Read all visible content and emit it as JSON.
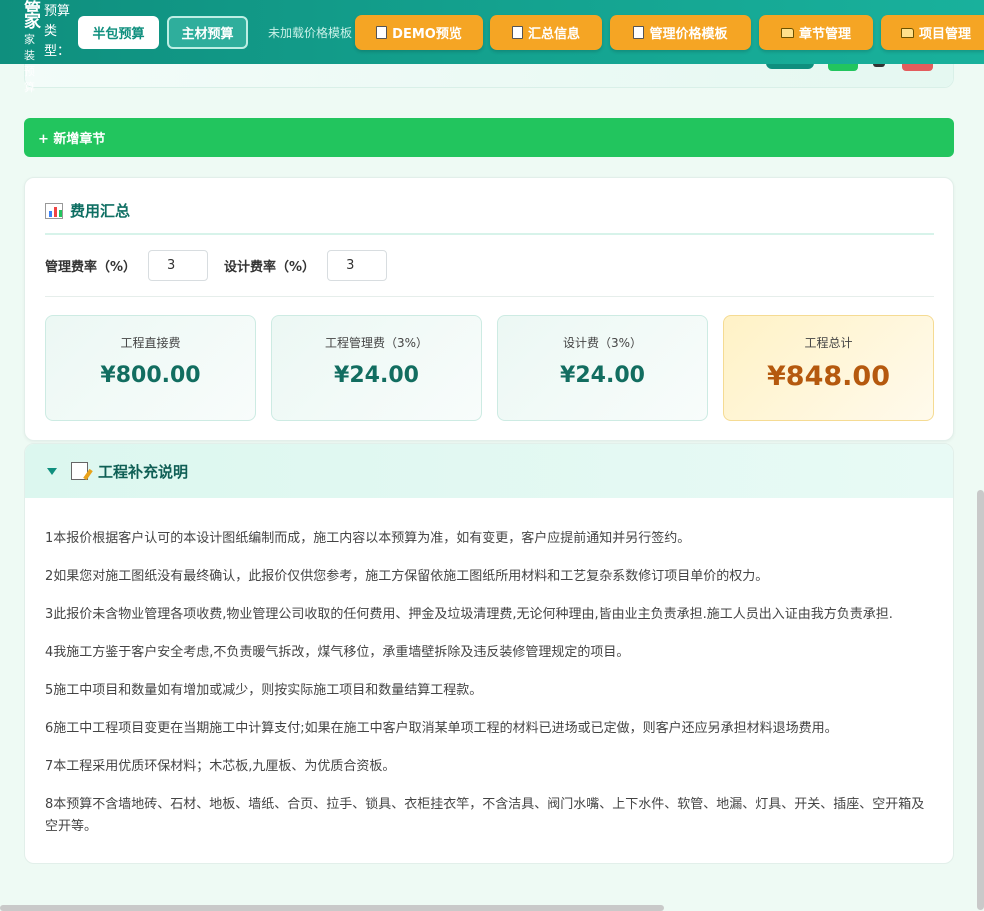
{
  "brand": {
    "line1": "管",
    "line2": "家",
    "sub": "家装预算"
  },
  "header": {
    "type_label": "预算类型：",
    "half_label": "半包预算",
    "main_label": "主材预算",
    "template_note": "未加载价格模板",
    "buttons": [
      {
        "label": "DEMO预览",
        "icon": "document-icon"
      },
      {
        "label": "汇总信息",
        "icon": "clipboard-icon"
      },
      {
        "label": "管理价格模板",
        "icon": "page-icon"
      },
      {
        "label": "章节管理",
        "icon": "folder-icon"
      },
      {
        "label": "项目管理",
        "icon": "folder-icon"
      }
    ]
  },
  "new_chapter": {
    "label": "+ 新增章节"
  },
  "summary": {
    "title": "费用汇总",
    "mgmt_rate_label": "管理费率（%）",
    "mgmt_rate_value": "3",
    "design_rate_label": "设计费率（%）",
    "design_rate_value": "3",
    "stats": [
      {
        "title": "工程直接费",
        "value": "¥800.00"
      },
      {
        "title": "工程管理费（3%）",
        "value": "¥24.00"
      },
      {
        "title": "设计费（3%）",
        "value": "¥24.00"
      },
      {
        "title": "工程总计",
        "value": "¥848.00"
      }
    ]
  },
  "supplement": {
    "title": "工程补充说明",
    "notes": [
      "1本报价根据客户认可的本设计图纸编制而成，施工内容以本预算为准，如有变更，客户应提前通知并另行签约。",
      "2如果您对施工图纸没有最终确认，此报价仅供您参考，施工方保留依施工图纸所用材料和工艺复杂系数修订项目单价的权力。",
      "3此报价未含物业管理各项收费,物业管理公司收取的任何费用、押金及垃圾清理费,无论何种理由,皆由业主负责承担.施工人员出入证由我方负责承担.",
      "4我施工方鉴于客户安全考虑,不负责暖气拆改，煤气移位，承重墙壁拆除及违反装修管理规定的项目。",
      "5施工中项目和数量如有增加或减少，则按实际施工项目和数量结算工程款。",
      "6施工中工程项目变更在当期施工中计算支付;如果在施工中客户取消某单项工程的材料已进场或已定做，则客户还应另承担材料退场费用。",
      "7本工程采用优质环保材料；木芯板,九厘板、为优质合资板。",
      "8本预算不含墙地砖、石材、地板、墙纸、合页、拉手、锁具、衣柜挂衣竿，不含洁具、阀门水嘴、上下水件、软管、地漏、灯具、开关、插座、空开箱及空开等。"
    ]
  },
  "colors": {
    "header": "#14a390",
    "orange": "#f5a524",
    "green": "#22c55e",
    "teal_text": "#126d60",
    "total_text": "#b5590e"
  }
}
